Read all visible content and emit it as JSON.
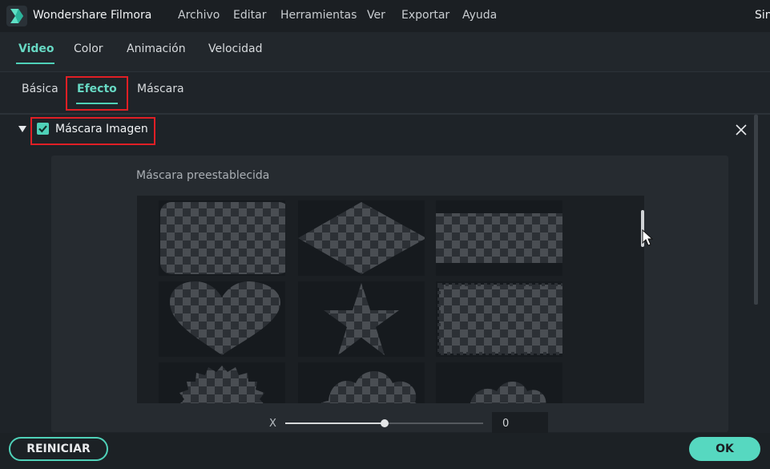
{
  "app": {
    "title": "Wondershare Filmora",
    "logo_icon": "filmora-logo-icon",
    "right_text": "Sin"
  },
  "menu": [
    "Archivo",
    "Editar",
    "Herramientas",
    "Ver",
    "Exportar",
    "Ayuda"
  ],
  "main_tabs": [
    {
      "label": "Video",
      "active": true
    },
    {
      "label": "Color",
      "active": false
    },
    {
      "label": "Animación",
      "active": false
    },
    {
      "label": "Velocidad",
      "active": false
    }
  ],
  "sub_tabs": [
    {
      "label": "Básica",
      "active": false
    },
    {
      "label": "Efecto",
      "active": true
    },
    {
      "label": "Máscara",
      "active": false
    }
  ],
  "section": {
    "label": "Máscara Imagen",
    "checked": true,
    "collapse_icon": "triangle-down-icon",
    "close_icon": "close-icon"
  },
  "presets": {
    "title": "Máscara preestablecida",
    "shapes": [
      "rounded-rectangle",
      "diamond",
      "rectangle",
      "heart",
      "star",
      "stamp-rectangle",
      "starburst-circle",
      "cloud",
      "cloud-small"
    ]
  },
  "slider": {
    "label": "X",
    "value": "0",
    "position_fraction": 0.5
  },
  "buttons": {
    "reset": "REINICIAR",
    "ok": "OK"
  },
  "colors": {
    "accent": "#4fd1b8",
    "highlight_box": "#e01f25",
    "background": "#1e2328"
  }
}
